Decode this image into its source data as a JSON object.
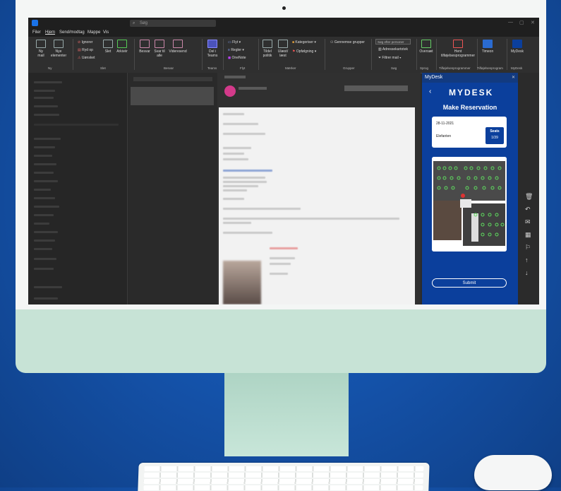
{
  "outlook": {
    "search_placeholder": "Søg",
    "menu": [
      "Filer",
      "Hjem",
      "Send/modtag",
      "Mappe",
      "Vis"
    ],
    "ribbon": {
      "new_mail": "Ny mail",
      "new_items": "Nye elementer",
      "ignore": "Ignorer",
      "clean_up": "Ryd op",
      "junk": "Uønsket",
      "delete": "Slet",
      "archive": "Arkivér",
      "reply": "Besvar",
      "reply_all": "Svar til alle",
      "forward": "Videresend",
      "share_teams": "Del i Teams",
      "move": "Flyt",
      "rules": "Regler",
      "onenote": "OneNote",
      "unread_read": "Ulæst/ læst",
      "categorize": "Kategoriser",
      "follow_up": "Opfølgning",
      "tidsel": "Tildel politik",
      "community": "Gennemse grupper",
      "search_people": "Søg efter personer",
      "address_book": "Adressekartotek",
      "filter_mail": "Filtrer mail",
      "read_aloud": "Oversæt",
      "get_addins": "Hent tilføjelsesprogrammer",
      "timeon": "Timeon",
      "mydesk": "MyDesk"
    },
    "groups": [
      "Ny",
      "Slet",
      "Besvar",
      "Teams",
      "Flyt",
      "Mærker",
      "Grupper",
      "Søg",
      "Sprog",
      "Tilføjelsesprogrammer",
      "Tilføjelsesprogram",
      "MyDesk"
    ]
  },
  "mydesk": {
    "pane_title": "MyDesk",
    "logo": "MYDESK",
    "heading": "Make Reservation",
    "date": "28-11-2021",
    "room": "Elefanten",
    "seats_label": "Seats",
    "seats_value": "1/39",
    "submit": "Submit"
  }
}
